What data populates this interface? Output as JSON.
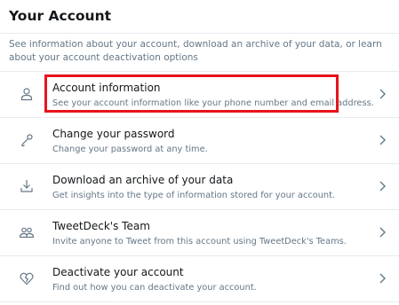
{
  "page": {
    "title": "Your Account",
    "description": "See information about your account, download an archive of your data, or learn about your account deactivation options"
  },
  "menu": {
    "items": [
      {
        "label": "Account information",
        "sub": "See your account information like your phone number and email address.",
        "icon": "person-icon",
        "highlighted": true
      },
      {
        "label": "Change your password",
        "sub": "Change your password at any time.",
        "icon": "key-icon"
      },
      {
        "label": "Download an archive of your data",
        "sub": "Get insights into the type of information stored for your account.",
        "icon": "download-icon"
      },
      {
        "label": "TweetDeck's Team",
        "sub": "Invite anyone to Tweet from this account using TweetDeck's Teams.",
        "icon": "team-icon"
      },
      {
        "label": "Deactivate your account",
        "sub": "Find out how you can deactivate your account.",
        "icon": "broken-heart-icon"
      }
    ]
  },
  "colors": {
    "highlight": "#e8141d",
    "secondary_text": "#657786",
    "divider": "#e6ecf0"
  }
}
